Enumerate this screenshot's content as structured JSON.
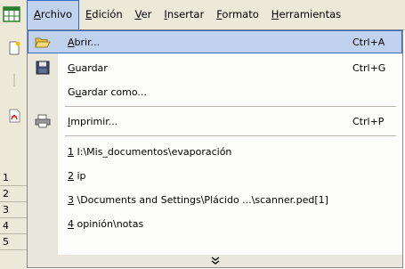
{
  "menubar": {
    "items": [
      {
        "pre": "",
        "ul": "A",
        "post": "rchivo"
      },
      {
        "pre": "",
        "ul": "E",
        "post": "dición"
      },
      {
        "pre": "",
        "ul": "V",
        "post": "er"
      },
      {
        "pre": "",
        "ul": "I",
        "post": "nsertar"
      },
      {
        "pre": "",
        "ul": "F",
        "post": "ormato"
      },
      {
        "pre": "",
        "ul": "H",
        "post": "erramientas"
      }
    ]
  },
  "row_headers": [
    "1",
    "2",
    "3",
    "4",
    "5"
  ],
  "menu": {
    "abrir": {
      "pre": "",
      "ul": "A",
      "post": "brir...",
      "shortcut": "Ctrl+A"
    },
    "guardar": {
      "pre": "",
      "ul": "G",
      "post": "uardar",
      "shortcut": "Ctrl+G"
    },
    "guardar_como": {
      "pre": "G",
      "ul": "u",
      "post": "ardar como...",
      "shortcut": ""
    },
    "imprimir": {
      "pre": "",
      "ul": "I",
      "post": "mprimir...",
      "shortcut": "Ctrl+P"
    },
    "recent": [
      {
        "num": "1",
        "text": " I:\\Mis_documentos\\evaporación"
      },
      {
        "num": "2",
        "text": " ip"
      },
      {
        "num": "3",
        "text": " \\Documents and Settings\\Plácido ...\\scanner.ped[1]"
      },
      {
        "num": "4",
        "text": " opinión\\notas"
      }
    ],
    "expand_glyph": "¥"
  },
  "icons": {
    "app": "spreadsheet-app-icon",
    "open": "open-folder-icon",
    "save": "floppy-disk-icon",
    "print": "printer-icon",
    "expand": "double-chevron-down-icon"
  },
  "colors": {
    "highlight": "#c1d2ee",
    "highlight_border": "#316ac5",
    "gutter": "#e9e7db",
    "menubar": "#ece9d8"
  }
}
